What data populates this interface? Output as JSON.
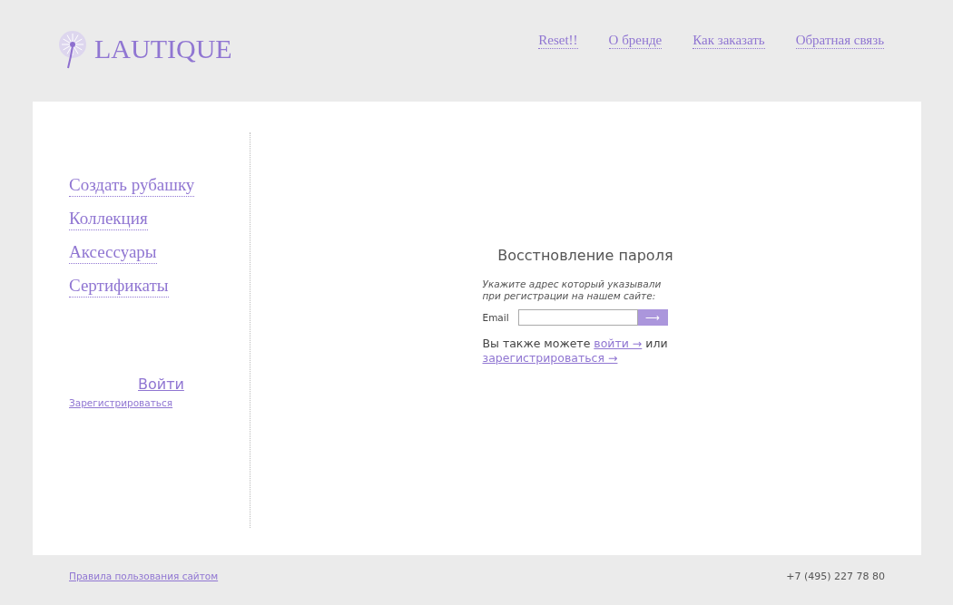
{
  "logo": {
    "text": "LAUTIQUE"
  },
  "nav": [
    "Reset!!",
    "О бренде",
    "Как заказать",
    "Обратная связь"
  ],
  "sidebar": {
    "items": [
      "Создать рубашку",
      "Коллекция",
      "Аксессуары",
      "Сертификаты"
    ],
    "login": "Войти",
    "register": "Зарегистрироваться"
  },
  "form": {
    "title": "Восстновление пароля",
    "hint": "Укажите адрес который указывали при регистрации на нашем сайте:",
    "email_label": "Email",
    "submit": "⟶",
    "also": "Вы также можете",
    "login_link": "войти →",
    "or": "или",
    "register_link": "зарегистрироваться →"
  },
  "footer": {
    "rules": "Правила пользования сайтом",
    "phone": "+7 (495) 227 78 80"
  }
}
